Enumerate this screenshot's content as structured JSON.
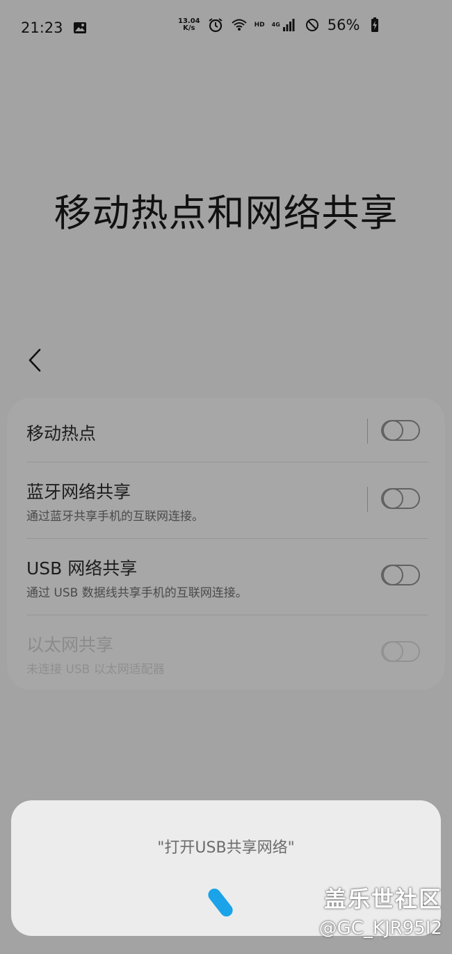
{
  "status_bar": {
    "time": "21:23",
    "net_speed_value": "13.04",
    "net_speed_unit": "K/s",
    "hd_label": "HD",
    "network_label": "4G",
    "battery": "56%"
  },
  "page": {
    "title": "移动热点和网络共享"
  },
  "settings": [
    {
      "title": "移动热点",
      "subtitle": ""
    },
    {
      "title": "蓝牙网络共享",
      "subtitle": "通过蓝牙共享手机的互联网连接。"
    },
    {
      "title": "USB 网络共享",
      "subtitle": "通过 USB 数据线共享手机的互联网连接。"
    },
    {
      "title": "以太网共享",
      "subtitle": "未连接 USB 以太网适配器"
    }
  ],
  "voice_assistant": {
    "prompt": "\"打开USB共享网络\""
  },
  "watermark": {
    "brand": "盖乐世社区",
    "user": "@GC_KJR95I2"
  },
  "colors": {
    "accent": "#1aa3e8",
    "dim_background": "#a3a3a3"
  }
}
